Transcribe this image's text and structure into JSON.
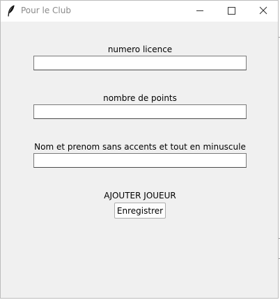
{
  "window": {
    "title": "Pour le Club",
    "icon": "feather-icon",
    "controls": [
      "minimize-icon",
      "maximize-icon",
      "close-icon"
    ]
  },
  "form": {
    "fields": [
      {
        "label": "numero licence",
        "value": "",
        "placeholder": ""
      },
      {
        "label": "nombre de points",
        "value": "",
        "placeholder": ""
      },
      {
        "label": "Nom et prenom sans accents et tout en minuscule",
        "value": "",
        "placeholder": ""
      }
    ],
    "section_title": "AJOUTER JOUEUR",
    "save_label": "Enregistrer"
  },
  "colors": {
    "window_bg": "#f0f0f0",
    "titlebar_bg": "#ffffff",
    "title_text": "#8a8a8a"
  }
}
